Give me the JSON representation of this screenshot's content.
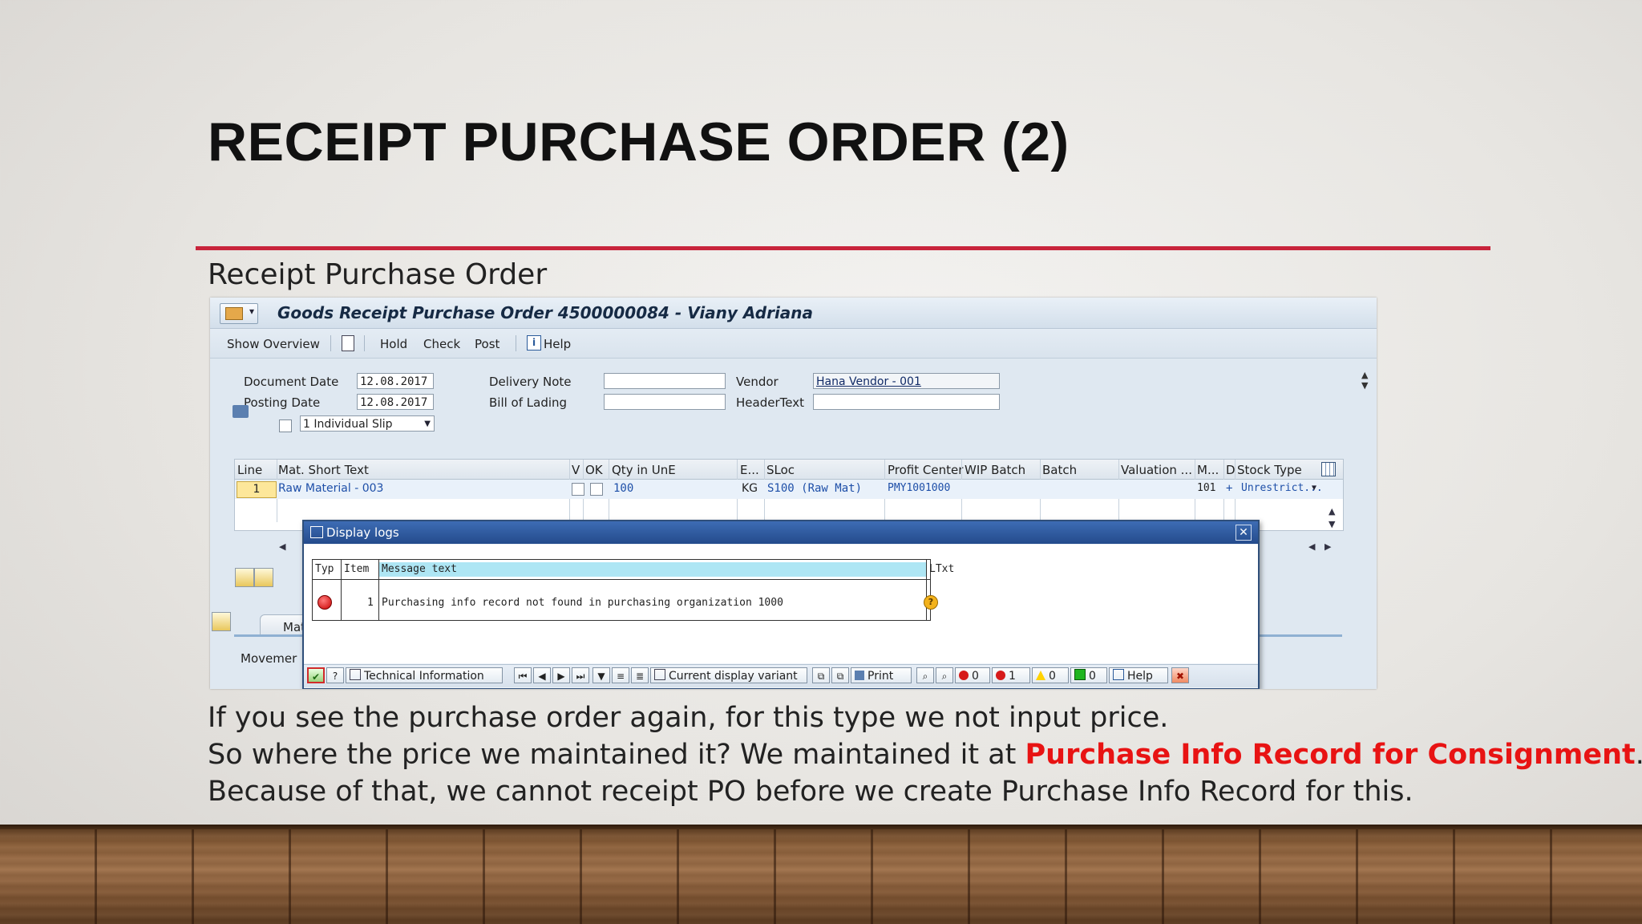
{
  "slide": {
    "title": "RECEIPT PURCHASE ORDER (2)",
    "subtitle": "Receipt Purchase Order",
    "paragraph": {
      "line1": "If you see the purchase order again, for this type we not input price.",
      "line2_prefix": "So where the price we maintained it? We maintained it at ",
      "line2_highlight": "Purchase Info Record for Consignment",
      "line2_suffix": ".",
      "line3": "Because of that, we cannot receipt PO before we create Purchase Info Record for this."
    },
    "colors": {
      "accent_rule": "#c8243b",
      "highlight_text": "#e81313"
    }
  },
  "sap": {
    "window_title": "Goods Receipt Purchase Order 4500000084 - Viany Adriana",
    "toolbar": {
      "show_overview": "Show Overview",
      "hold": "Hold",
      "check": "Check",
      "post": "Post",
      "help": "Help"
    },
    "header": {
      "document_date_label": "Document Date",
      "document_date": "12.08.2017",
      "posting_date_label": "Posting Date",
      "posting_date": "12.08.2017",
      "slip_option": "1 Individual Slip",
      "delivery_note_label": "Delivery Note",
      "delivery_note": "",
      "bill_of_lading_label": "Bill of Lading",
      "bill_of_lading": "",
      "vendor_label": "Vendor",
      "vendor": "Hana Vendor - 001",
      "header_text_label": "HeaderText",
      "header_text": ""
    },
    "grid": {
      "columns": [
        "Line",
        "Mat. Short Text",
        "V",
        "OK",
        "Qty in UnE",
        "E...",
        "SLoc",
        "Profit Center",
        "WIP Batch",
        "Batch",
        "Valuation ...",
        "M...",
        "D",
        "Stock Type"
      ],
      "row": {
        "line": "1",
        "mat_short_text": "Raw Material - 003",
        "qty": "100",
        "unit": "KG",
        "sloc": "S100 (Raw Mat)",
        "profit_center": "PMY1001000",
        "movement": "101",
        "debit": "+",
        "stock_type": "Unrestrict..."
      }
    },
    "tab_label": "Materi",
    "bottom_label": "Movemer"
  },
  "dialog": {
    "title": "Display logs",
    "columns": [
      "Typ",
      "Item",
      "Message text",
      "LTxt"
    ],
    "rows": [
      {
        "item": "1",
        "message": "Purchasing info record not found in purchasing organization 1000"
      }
    ],
    "footer": {
      "technical_information": "Technical Information",
      "current_display_variant": "Current display variant",
      "print": "Print",
      "count_stop": "0",
      "count_error": "1",
      "count_warning": "0",
      "count_success": "0",
      "help": "Help"
    }
  }
}
